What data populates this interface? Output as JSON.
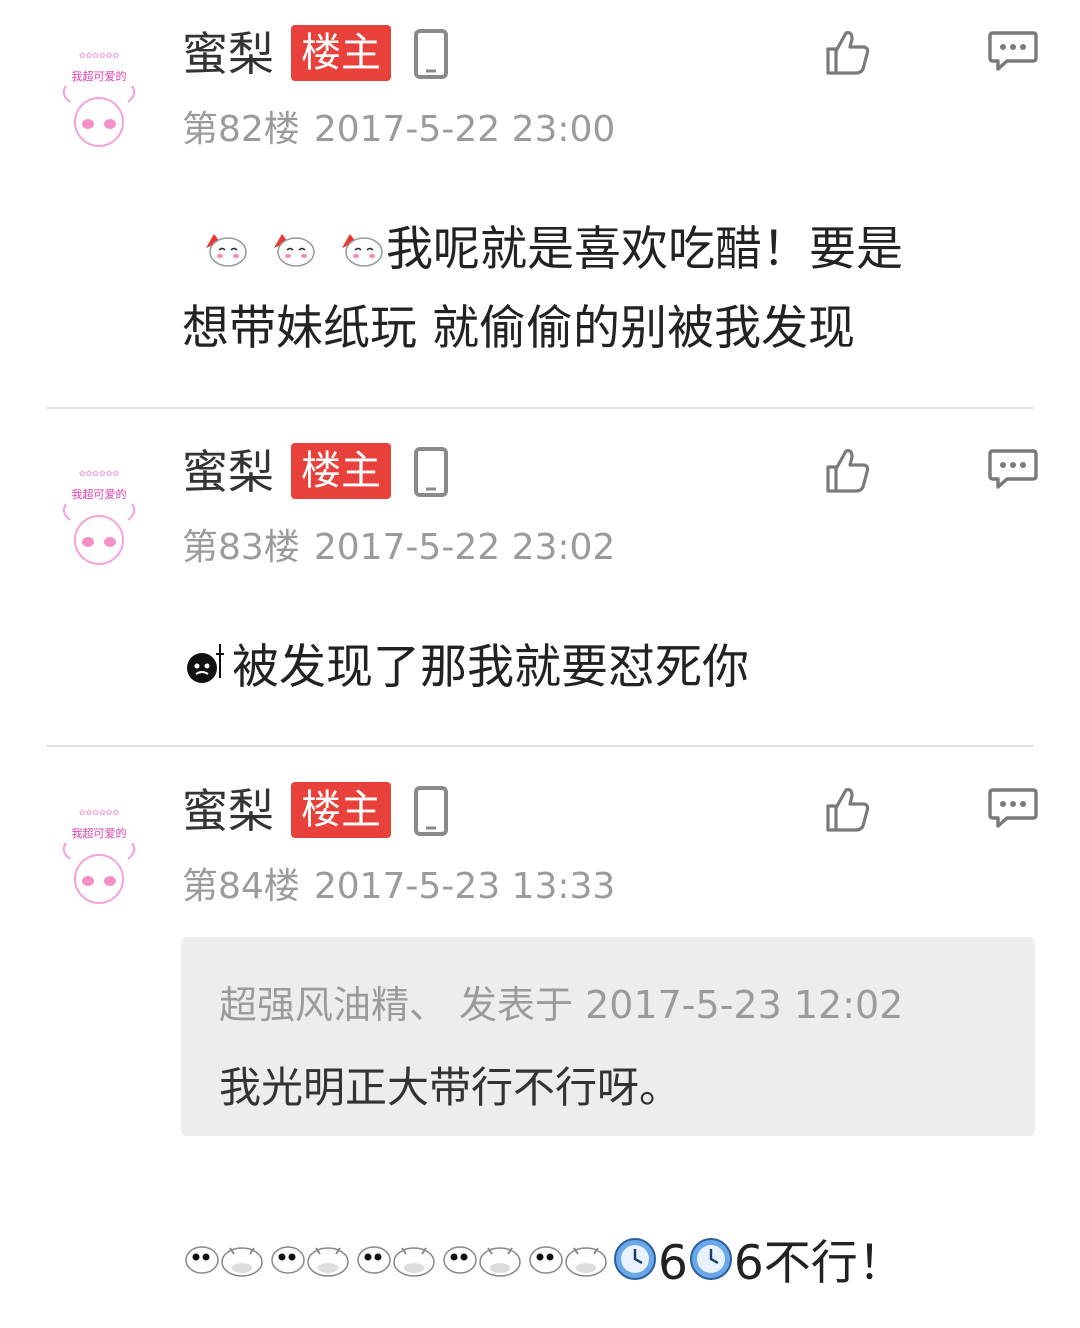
{
  "posts": [
    {
      "author": "蜜梨",
      "badge": "楼主",
      "floor": "第82楼",
      "time": "2017-5-22 23:00",
      "content_line1": "我呢就是喜欢吃醋！要是",
      "content_line2": "想带妹纸玩 就偷偷的别被我发现"
    },
    {
      "author": "蜜梨",
      "badge": "楼主",
      "floor": "第83楼",
      "time": "2017-5-22 23:02",
      "content": "被发现了那我就要怼死你"
    },
    {
      "author": "蜜梨",
      "badge": "楼主",
      "floor": "第84楼",
      "time": "2017-5-23 13:33",
      "quote": {
        "user": "超强风油精、",
        "posted": "发表于 2017-5-23 12:02",
        "text": "我光明正大带行不行呀。"
      },
      "content_a": "6",
      "content_b": "6不行！"
    }
  ],
  "avatar_text": [
    "我超可爱的"
  ],
  "colors": {
    "badge": "#e8403a",
    "meta": "#9b9b9b",
    "quote_bg": "#ededed",
    "avatar_pink": "#f06bc8"
  }
}
